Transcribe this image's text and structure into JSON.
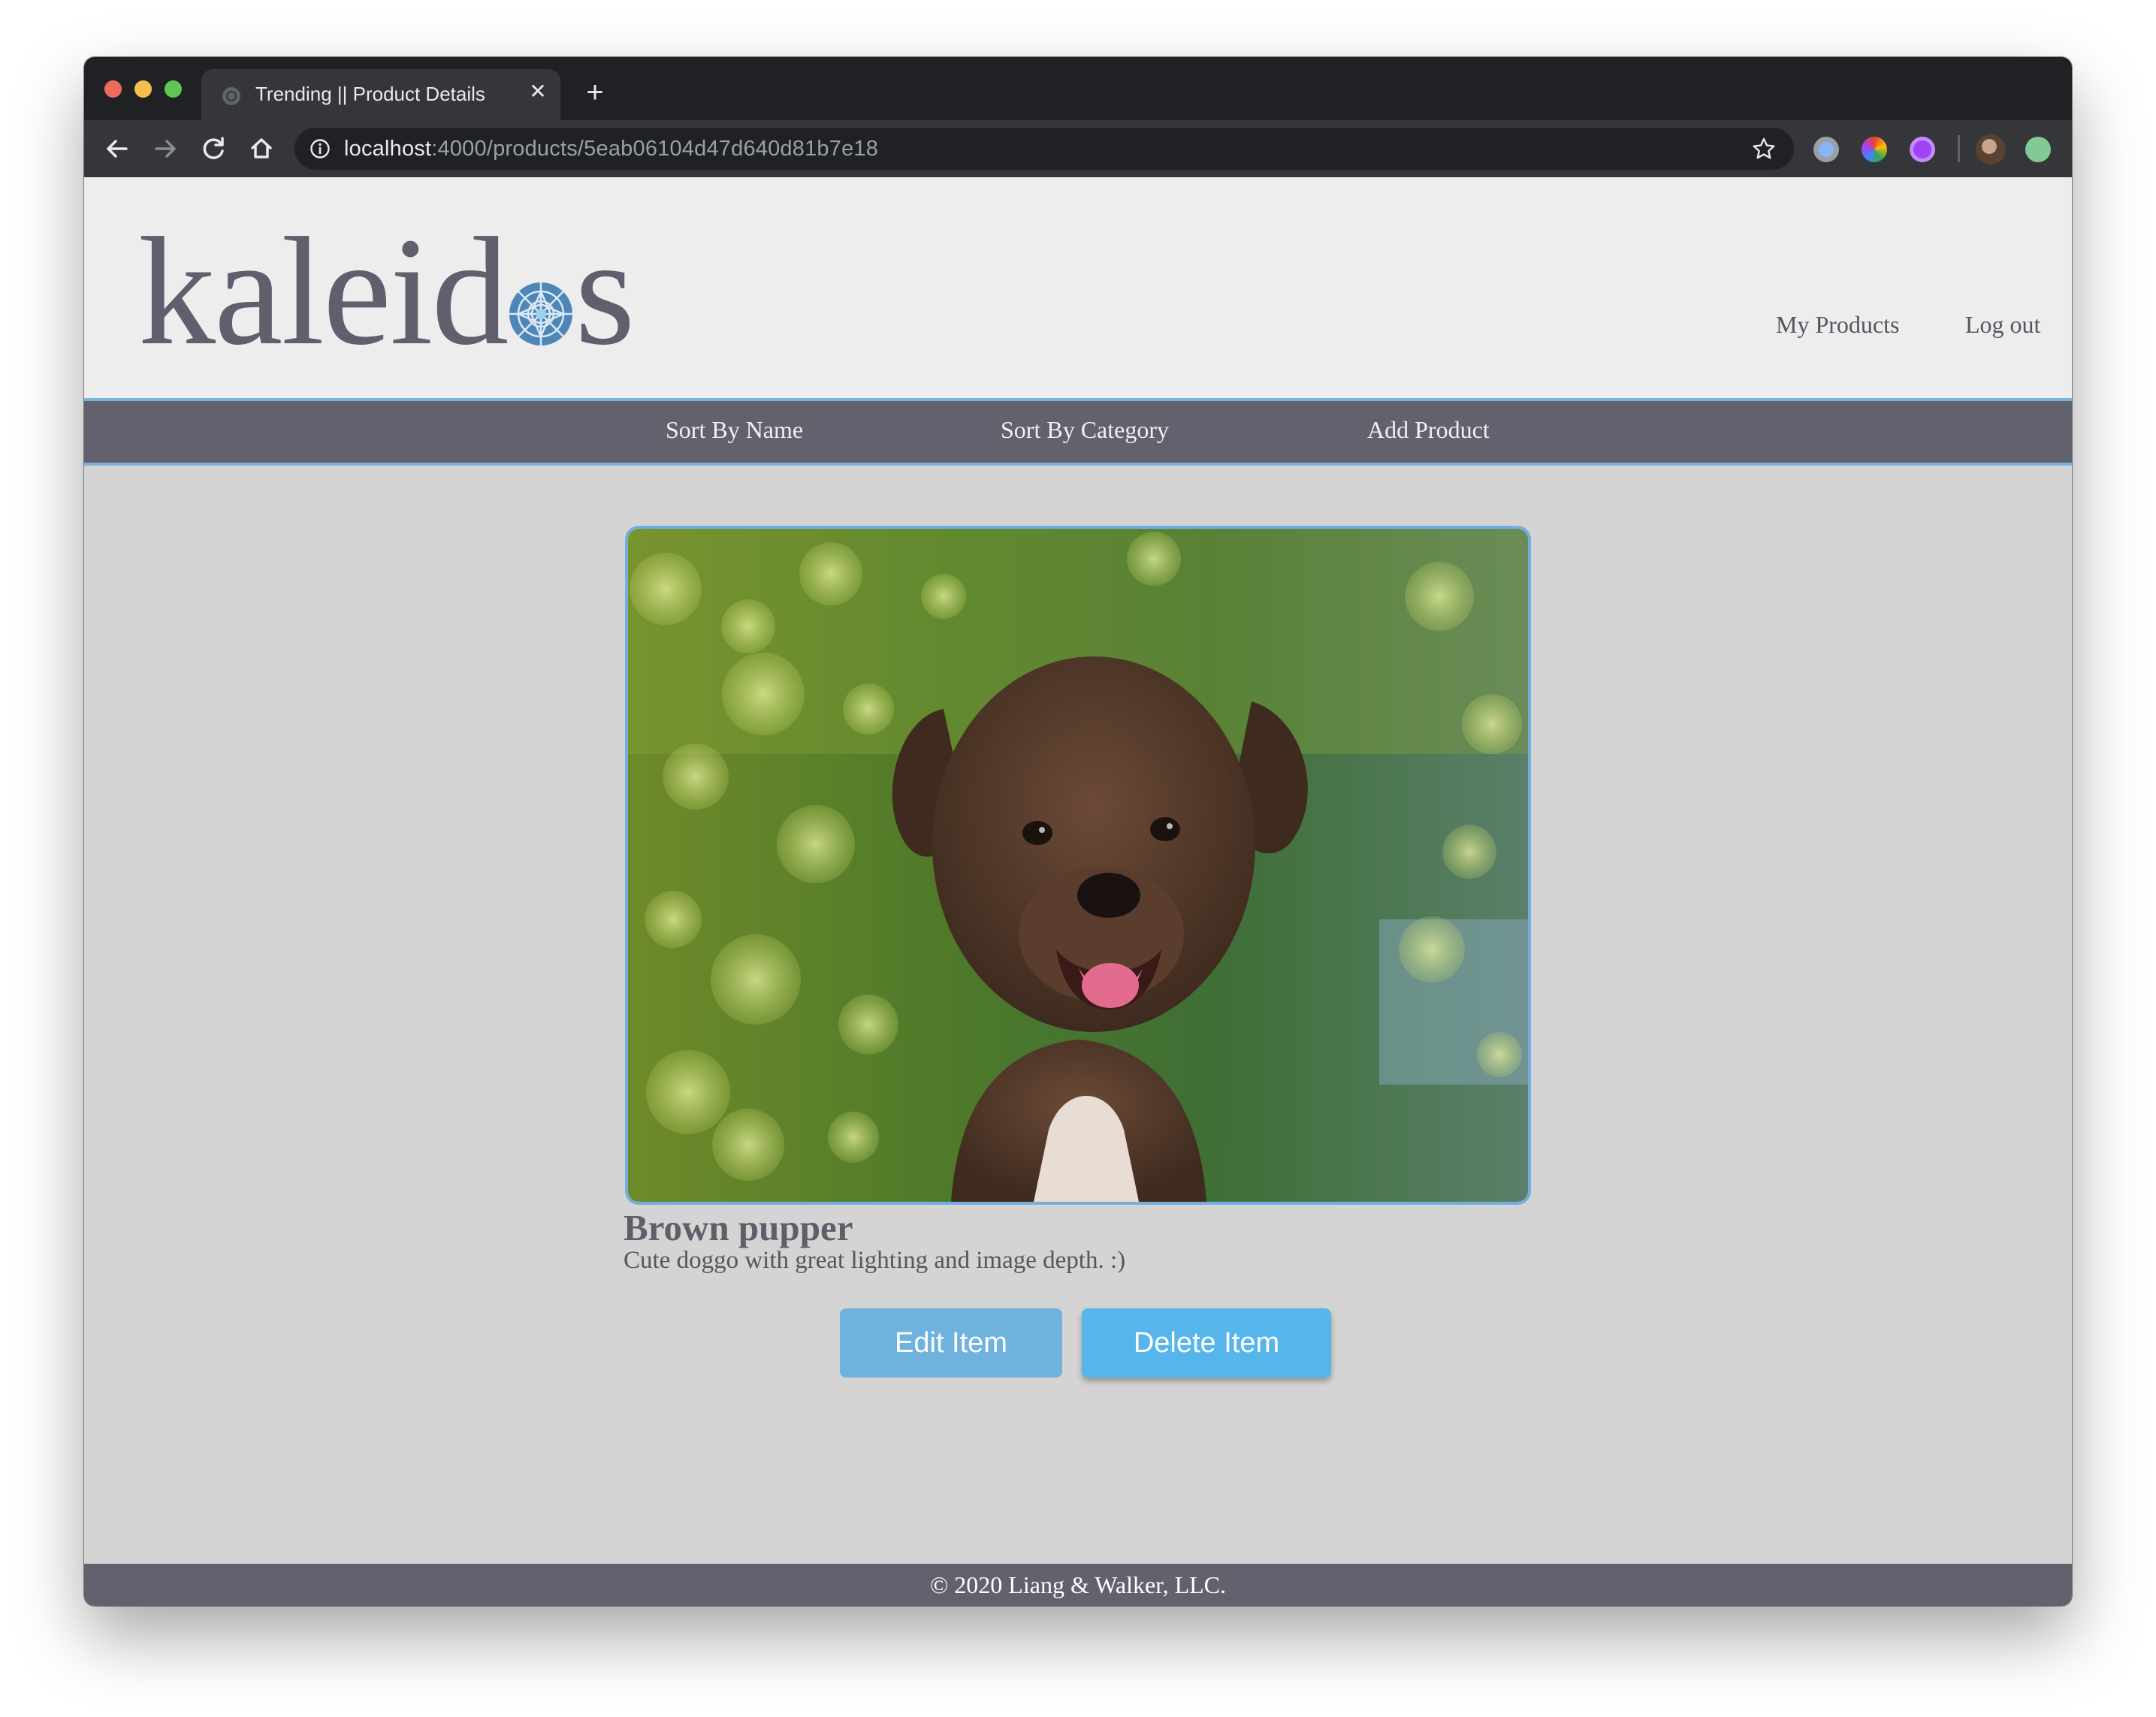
{
  "browser": {
    "tab_title": "Trending || Product Details",
    "url_host": "localhost",
    "url_path": ":4000/products/5eab06104d47d640d81b7e18"
  },
  "header": {
    "logo_left": "kaleid",
    "logo_right": "s",
    "links": [
      "My Products",
      "Log out"
    ]
  },
  "subnav": {
    "links": [
      "Sort By Name",
      "Sort By Category",
      "Add Product"
    ]
  },
  "product": {
    "title": "Brown pupper",
    "description": "Cute doggo with great lighting and image depth. :)"
  },
  "actions": {
    "edit_label": "Edit Item",
    "delete_label": "Delete Item"
  },
  "footer": {
    "text": "© 2020 Liang & Walker, LLC."
  },
  "colors": {
    "nav_bg": "#62626e",
    "accent_border": "#7bb2dc",
    "button_edit": "#6eb2dd",
    "button_delete": "#56b6eb"
  }
}
